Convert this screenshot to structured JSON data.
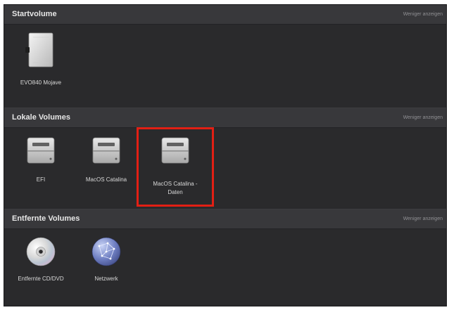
{
  "sections": [
    {
      "title": "Startvolume",
      "toggle": "Weniger anzeigen",
      "volumes": [
        {
          "label": "EVO840 Mojave",
          "icon": "internal-drive-icon"
        }
      ]
    },
    {
      "title": "Lokale Volumes",
      "toggle": "Weniger anzeigen",
      "volumes": [
        {
          "label": "EFI",
          "icon": "hard-drive-icon"
        },
        {
          "label": "MacOS Catalina",
          "icon": "hard-drive-icon"
        },
        {
          "label": "MacOS Catalina - Daten",
          "icon": "hard-drive-icon",
          "selected": true
        }
      ]
    },
    {
      "title": "Entfernte Volumes",
      "toggle": "Weniger anzeigen",
      "volumes": [
        {
          "label": "Entfernte CD/DVD",
          "icon": "optical-disc-icon"
        },
        {
          "label": "Netzwerk",
          "icon": "network-globe-icon"
        }
      ]
    }
  ],
  "colors": {
    "background": "#2a2a2c",
    "header": "#38383b",
    "text": "#e6e6e6",
    "selection_border": "#e21f14"
  }
}
